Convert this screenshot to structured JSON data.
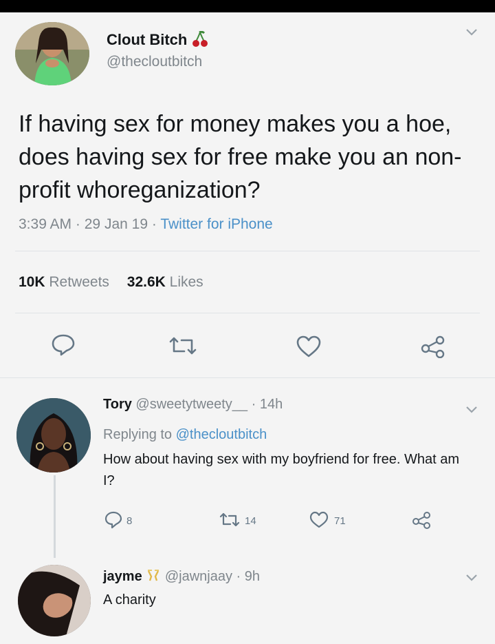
{
  "tweet": {
    "author_name": "Clout Bitch",
    "author_handle": "@thecloutbitch",
    "text": "If having sex for money makes you a hoe, does having sex for free make you an non-profit whoreganization?",
    "time": "3:39 AM",
    "date": "29 Jan 19",
    "source": "Twitter for iPhone",
    "retweets_count": "10K",
    "retweets_label": "Retweets",
    "likes_count": "32.6K",
    "likes_label": "Likes"
  },
  "replies": [
    {
      "author_name": "Tory",
      "author_handle": "@sweetytweety__",
      "age": "14h",
      "replying_to_label": "Replying to",
      "replying_to_handle": "@thecloutbitch",
      "text": "How about having sex with my boyfriend for free. What am I?",
      "reply_count": "8",
      "retweet_count": "14",
      "like_count": "71"
    },
    {
      "author_name": "jayme",
      "author_handle": "@jawnjaay",
      "age": "9h",
      "text": "A charity"
    }
  ],
  "icons": {
    "name_badge": "cherry-emoji-icon",
    "reply_name_badge": "champagne-emoji-icon",
    "reply": "reply-icon",
    "retweet": "retweet-icon",
    "like": "heart-icon",
    "share": "share-icon",
    "menu": "chevron-down-icon"
  },
  "colors": {
    "link": "#4a90c8",
    "muted": "#7f868c",
    "cherry": "#c81e28"
  }
}
